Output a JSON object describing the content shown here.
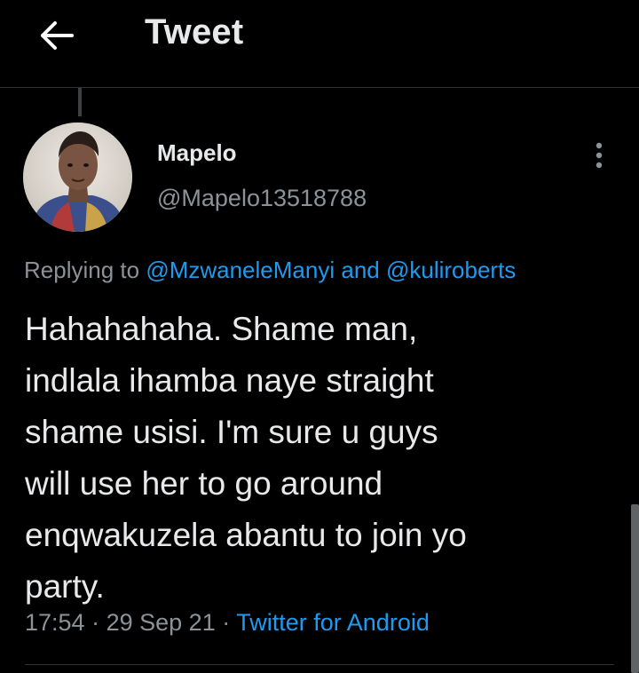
{
  "header": {
    "title": "Tweet",
    "back_icon": "arrow-left-icon"
  },
  "tweet": {
    "author": {
      "name": "Mapelo",
      "handle": "@Mapelo13518788",
      "avatar_icon": "user-avatar-image"
    },
    "more_icon": "more-vertical-icon",
    "reply_context": {
      "prefix": "Replying to",
      "mention_1": "@MzwaneleManyi",
      "conjunction": "and",
      "mention_2": "@kuliroberts"
    },
    "body_lines": [
      "Hahahahaha. Shame man,",
      "indlala ihamba naye straight",
      "shame usisi. I'm sure u guys",
      "will use her to go around",
      "enqwakuzela abantu to join yo",
      "party."
    ],
    "meta": {
      "time": "17:54",
      "separator": "·",
      "date": "29 Sep 21",
      "source": "Twitter for Android"
    }
  },
  "colors": {
    "background": "#000000",
    "text_primary": "#e7e9ea",
    "text_secondary": "#8b9298",
    "link": "#1d9bf0",
    "divider": "#2f3336"
  }
}
